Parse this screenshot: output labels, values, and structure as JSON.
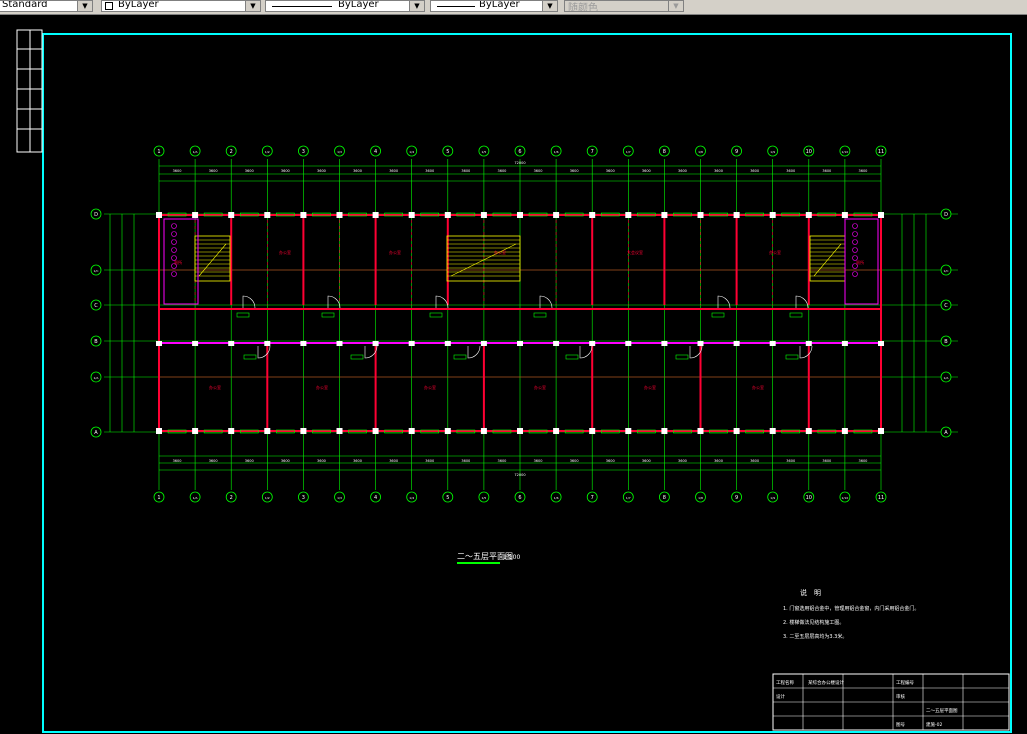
{
  "toolbar": {
    "text_style": "Standard",
    "layer": "ByLayer",
    "linetype": "ByLayer",
    "lineweight": "ByLayer",
    "plot_style": "随颜色"
  },
  "plan": {
    "grid_labels": [
      "1",
      "1/A",
      "2",
      "1/2",
      "3",
      "1/3",
      "4",
      "1/4",
      "5",
      "1/5",
      "6",
      "1/6",
      "7",
      "1/7",
      "8",
      "1/8",
      "9",
      "1/9",
      "10",
      "1/10",
      "11"
    ],
    "row_labels": [
      "D",
      "1/C",
      "C",
      "B",
      "1/A",
      "A"
    ],
    "bay_dims": [
      "3600",
      "3600",
      "3600",
      "3600",
      "3600",
      "3600",
      "3600",
      "3600",
      "3600",
      "3600",
      "3600",
      "3600",
      "3600",
      "3600",
      "3600",
      "3600",
      "3600",
      "3600",
      "3600",
      "3600"
    ],
    "overall_dim": "72000",
    "room_labels": [
      "办公室",
      "办公室",
      "办公室",
      "办公室",
      "办公室",
      "办公室",
      "办公室",
      "办公室",
      "办公室",
      "办公室",
      "大会议室",
      "厕所",
      "厕所"
    ],
    "title": "二～五层平面图",
    "scale": "1:100"
  },
  "notes": {
    "heading": "说　明",
    "items": [
      "1. 门窗选用铝合金中，管理用铝合金窗，内门采用铝合金门。",
      "2. 楼梯做法见结构施工图。",
      "3. 二至五层层高均为3.3米。"
    ]
  },
  "title_block": {
    "cells": [
      "工程名称",
      "某综合办公楼设计",
      "工程编号",
      "",
      "设计",
      "",
      "审核",
      "",
      "二～五层平面图",
      "",
      "图号",
      "建施-02"
    ]
  },
  "colors": {
    "background": "#000000",
    "frame": "#00ffff",
    "grid": "#00ff00",
    "wall": "#ff0033",
    "door": "#ffffff",
    "magenta": "#ff00ff",
    "stair": "#ffff00"
  }
}
